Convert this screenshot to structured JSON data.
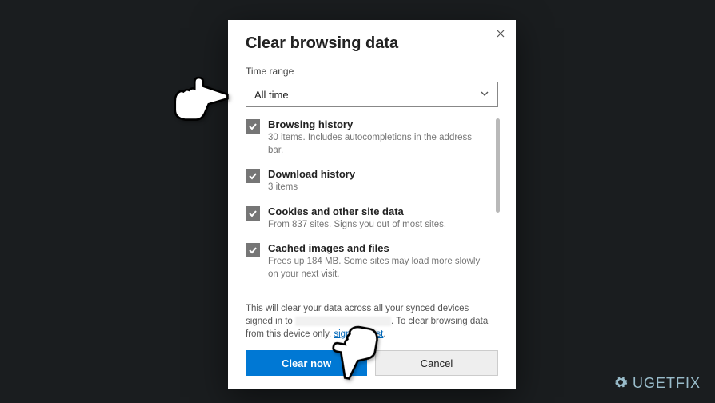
{
  "dialog": {
    "title": "Clear browsing data",
    "time_range_label": "Time range",
    "time_range_value": "All time",
    "items": [
      {
        "title": "Browsing history",
        "sub": "30 items. Includes autocompletions in the address bar."
      },
      {
        "title": "Download history",
        "sub": "3 items"
      },
      {
        "title": "Cookies and other site data",
        "sub": "From 837 sites. Signs you out of most sites."
      },
      {
        "title": "Cached images and files",
        "sub": "Frees up 184 MB. Some sites may load more slowly on your next visit."
      }
    ],
    "sync_text_1": "This will clear your data across all your synced devices signed in to ",
    "sync_text_2": ". To clear browsing data from this device only, ",
    "sign_out_link": "sign out first",
    "sync_text_3": ".",
    "clear_button": "Clear now",
    "cancel_button": "Cancel"
  },
  "watermark": "UGETFIX"
}
